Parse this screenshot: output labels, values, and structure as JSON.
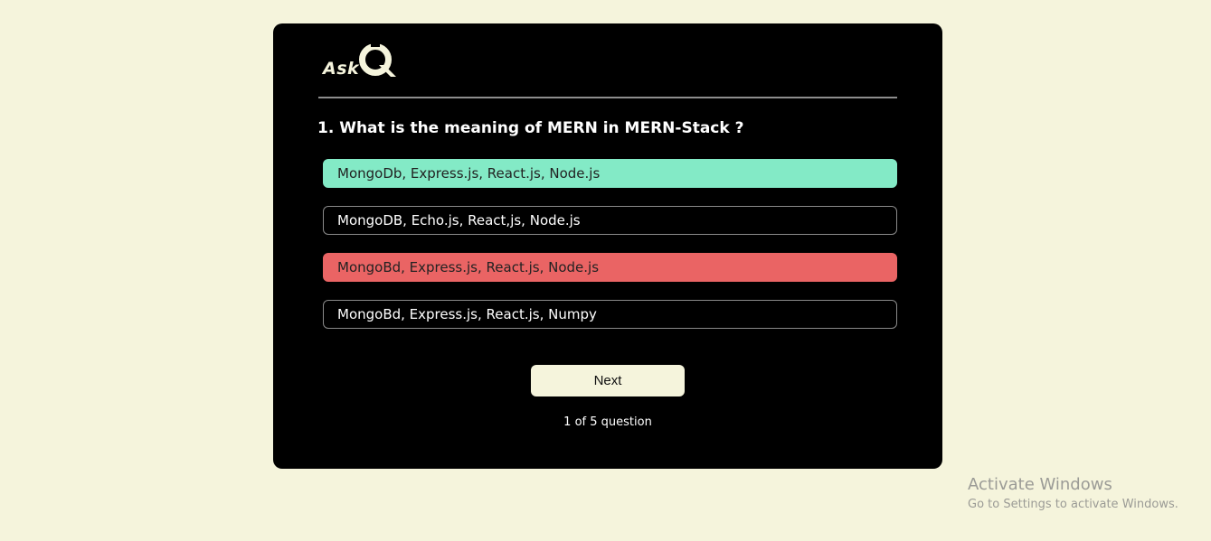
{
  "logo": {
    "text": "Ask",
    "mark": "Q"
  },
  "colors": {
    "page_background": "#f5f4dc",
    "card_background": "#000000",
    "correct_option": "#83eac6",
    "wrong_option": "#ea6464",
    "next_button": "#f5f4dc"
  },
  "quiz": {
    "question": "1. What is the meaning of MERN in MERN-Stack ?",
    "options": [
      {
        "label": "MongoDb, Express.js, React.js, Node.js",
        "state": "correct"
      },
      {
        "label": "MongoDB, Echo.js, React,js, Node.js",
        "state": "default"
      },
      {
        "label": "MongoBd, Express.js, React.js, Node.js",
        "state": "wrong"
      },
      {
        "label": "MongoBd, Express.js, React.js, Numpy",
        "state": "default"
      }
    ],
    "next_label": "Next",
    "progress_text": "1 of 5 question"
  },
  "watermark": {
    "title": "Activate Windows",
    "subtitle": "Go to Settings to activate Windows."
  }
}
